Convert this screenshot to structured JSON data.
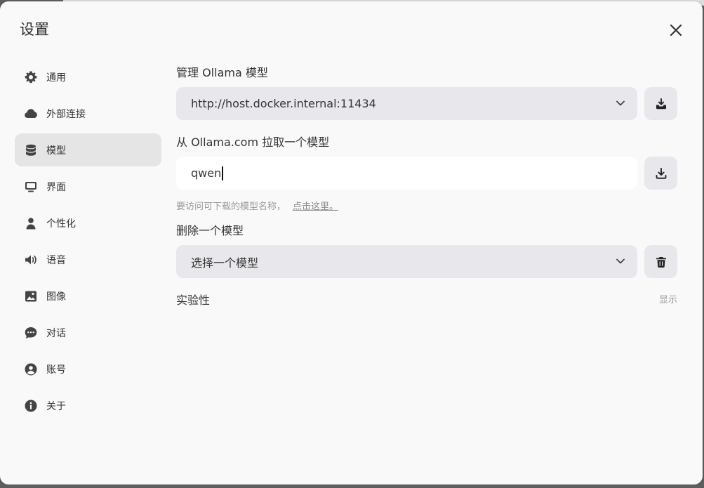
{
  "dialog": {
    "title": "设置"
  },
  "sidebar": {
    "items": [
      {
        "label": "通用",
        "icon": "gear-icon"
      },
      {
        "label": "外部连接",
        "icon": "cloud-icon"
      },
      {
        "label": "模型",
        "icon": "database-icon",
        "active": true
      },
      {
        "label": "界面",
        "icon": "monitor-icon"
      },
      {
        "label": "个性化",
        "icon": "user-icon"
      },
      {
        "label": "语音",
        "icon": "speaker-icon"
      },
      {
        "label": "图像",
        "icon": "image-icon"
      },
      {
        "label": "对话",
        "icon": "chat-icon"
      },
      {
        "label": "账号",
        "icon": "account-icon"
      },
      {
        "label": "关于",
        "icon": "info-icon"
      }
    ]
  },
  "main": {
    "manage": {
      "label": "管理 Ollama 模型",
      "selected_url": "http://host.docker.internal:11434"
    },
    "pull": {
      "label": "从 Ollama.com 拉取一个模型",
      "value": "qwen",
      "hint": "要访问可下载的模型名称，",
      "hint_link": "点击这里。"
    },
    "delete": {
      "label": "删除一个模型",
      "placeholder": "选择一个模型"
    },
    "experimental": {
      "label": "实验性",
      "toggle_label": "显示"
    }
  },
  "colors": {
    "modal_bg": "#f9f9f9",
    "active_nav_bg": "#e5e5e5",
    "field_bg": "#e8e8ec"
  }
}
